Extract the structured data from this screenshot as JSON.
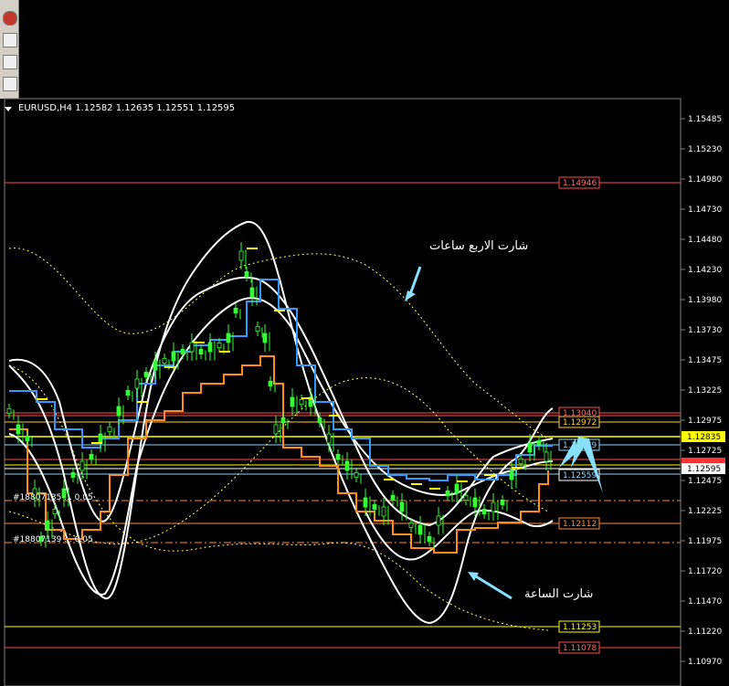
{
  "window": {
    "symbol_info": "EURUSD,H4  1.12582 1.12635 1.12551 1.12595"
  },
  "annotations": {
    "four_hour_chart": "شارت الاربع ساعات",
    "hour_chart": "شارت الساعة"
  },
  "orders": {
    "order_1": "#18807135 ... 0.05",
    "order_2": "#18807139 ... 0.05"
  },
  "price_axis": {
    "ticks": [
      "1.15485",
      "1.15230",
      "1.14980",
      "1.14730",
      "1.14480",
      "1.14230",
      "1.13980",
      "1.13730",
      "1.13475",
      "1.13225",
      "1.12975",
      "1.12725",
      "1.12475",
      "1.12225",
      "1.11975",
      "1.11720",
      "1.11470",
      "1.11220",
      "1.10970"
    ],
    "current_price_yellow": "1.12835",
    "current_price_white": "1.12595",
    "red_tag": "1.12???"
  },
  "levels": [
    {
      "value": "1.14946",
      "color": "#ff4d4d",
      "style": "solid"
    },
    {
      "value": "1.13040",
      "color": "#ff4d4d",
      "style": "solid"
    },
    {
      "value": "1.12972",
      "color": "#ffcc33",
      "style": "solid"
    },
    {
      "value": "1.12835",
      "color": "#ffff00",
      "style": "solid"
    },
    {
      "value": "1.12779",
      "color": "#8fd3ff",
      "style": "solid"
    },
    {
      "value": "1.12559",
      "color": "#ffffff",
      "style": "solid"
    },
    {
      "value": "1.12112",
      "color": "#ff8c33",
      "style": "solid"
    },
    {
      "value": "1.11253",
      "color": "#ffff00",
      "style": "solid"
    },
    {
      "value": "1.11078",
      "color": "#ff4d4d",
      "style": "solid"
    }
  ],
  "level_labels": {
    "l1": "1.14946",
    "l2": "1.13040",
    "l3": "1.12972",
    "l4": "1.12779",
    "l5": "1.12559",
    "l6": "1.12112",
    "l7": "1.11253",
    "l8": "1.11078"
  },
  "colors": {
    "background": "#000000",
    "candle": "#33ff33",
    "bollinger": "#ffffff",
    "ma_blue": "#3399ff",
    "ma_orange": "#ff8c1a",
    "dotted": "#ffff66",
    "arrow": "#88e0ff"
  }
}
